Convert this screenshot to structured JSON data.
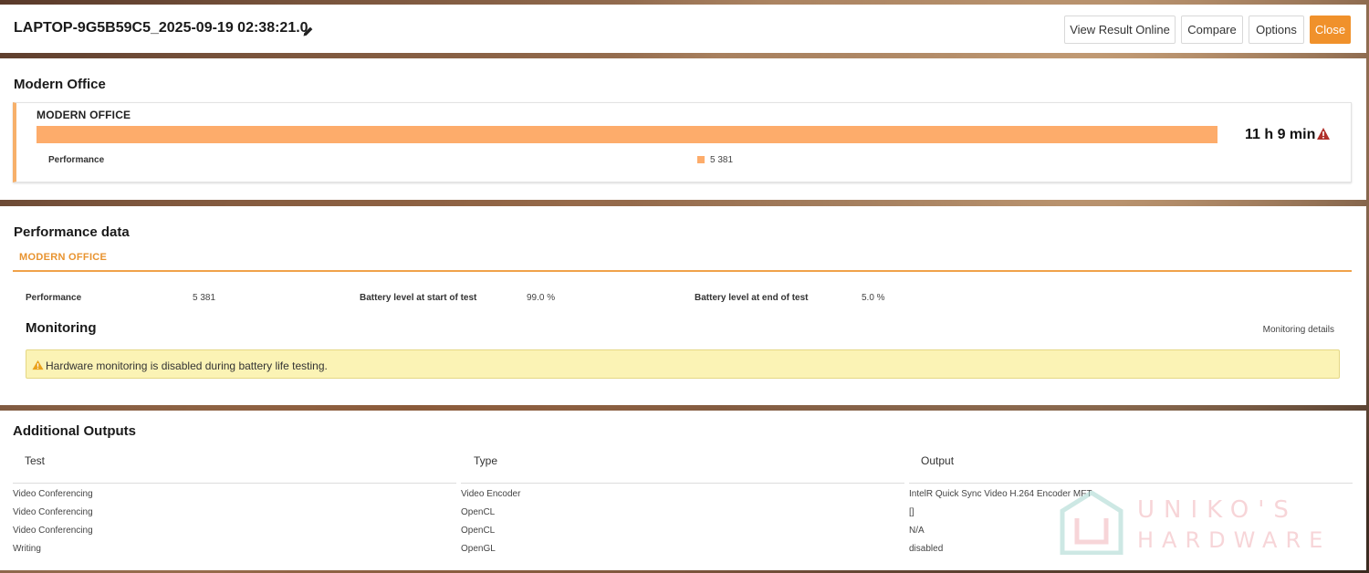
{
  "header": {
    "title": "LAPTOP-9G5B59C5_2025-09-19 02:38:21.0",
    "buttons": {
      "view_online": "View Result Online",
      "compare": "Compare",
      "options": "Options",
      "close": "Close"
    }
  },
  "modern_office": {
    "section_title": "Modern Office",
    "card_title": "MODERN OFFICE",
    "metric_label": "Performance",
    "metric_value": "5 381",
    "duration": "11 h 9 min",
    "bar_color": "#fdac6b"
  },
  "performance_data": {
    "section_title": "Performance data",
    "tab_label": "MODERN OFFICE",
    "items": [
      {
        "label": "Performance",
        "value": "5 381"
      },
      {
        "label": "Battery level at start of test",
        "value": "99.0 %"
      },
      {
        "label": "Battery level at end of test",
        "value": "5.0 %"
      }
    ],
    "monitoring": {
      "title": "Monitoring",
      "details_link": "Monitoring details",
      "alert_text": "Hardware monitoring is disabled during battery life testing."
    }
  },
  "additional_outputs": {
    "section_title": "Additional Outputs",
    "columns": [
      "Test",
      "Type",
      "Output"
    ],
    "rows": [
      [
        "Video Conferencing",
        "Video Encoder",
        "IntelR Quick Sync Video H.264 Encoder MFT"
      ],
      [
        "Video Conferencing",
        "OpenCL",
        "[]"
      ],
      [
        "Video Conferencing",
        "OpenCL",
        "N/A"
      ],
      [
        "Writing",
        "OpenGL",
        "disabled"
      ]
    ]
  },
  "watermark": {
    "line1": "UNIKO'S",
    "line2": "HARDWARE"
  },
  "colors": {
    "accent": "#f0912b",
    "bar": "#fdac6b",
    "alert_bg": "#fbf3b5",
    "warning_icon": "#b0302a"
  }
}
